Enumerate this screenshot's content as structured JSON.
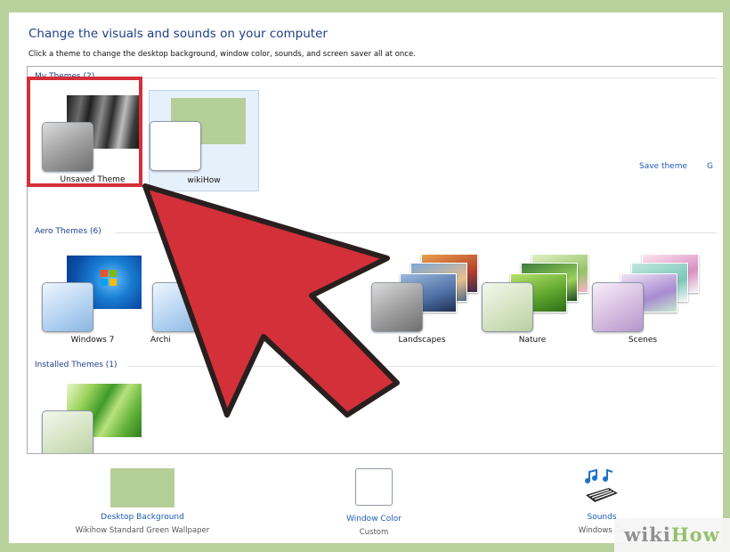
{
  "heading": "Change the visuals and sounds on your computer",
  "subheading": "Click a theme to change the desktop background, window color, sounds, and screen saver all at once.",
  "groups": {
    "my_themes": "My Themes (2)",
    "aero_themes": "Aero Themes (6)",
    "installed_themes": "Installed Themes (1)"
  },
  "themes": {
    "my": [
      {
        "name": "Unsaved Theme",
        "selected": true
      },
      {
        "name": "wikiHow"
      }
    ],
    "aero": [
      {
        "name": "Windows 7"
      },
      {
        "name": "Archi"
      },
      {
        "name": "Landscapes"
      },
      {
        "name": "Nature"
      },
      {
        "name": "Scenes"
      }
    ]
  },
  "links": {
    "save_theme": "Save theme",
    "get_more": "G"
  },
  "settings": {
    "desktop_background": {
      "title": "Desktop Background",
      "value": "Wikihow Standard Green Wallpaper"
    },
    "window_color": {
      "title": "Window Color",
      "value": "Custom"
    },
    "sounds": {
      "title": "Sounds",
      "value": "Windows De"
    }
  },
  "watermark": {
    "wiki": "wiki",
    "how": "How"
  },
  "colors": {
    "accent_link": "#1d5bb5",
    "heading": "#1e3f86",
    "selection_border": "#d3303a",
    "arrow": "#d3303a",
    "frame": "#b9d19c"
  }
}
